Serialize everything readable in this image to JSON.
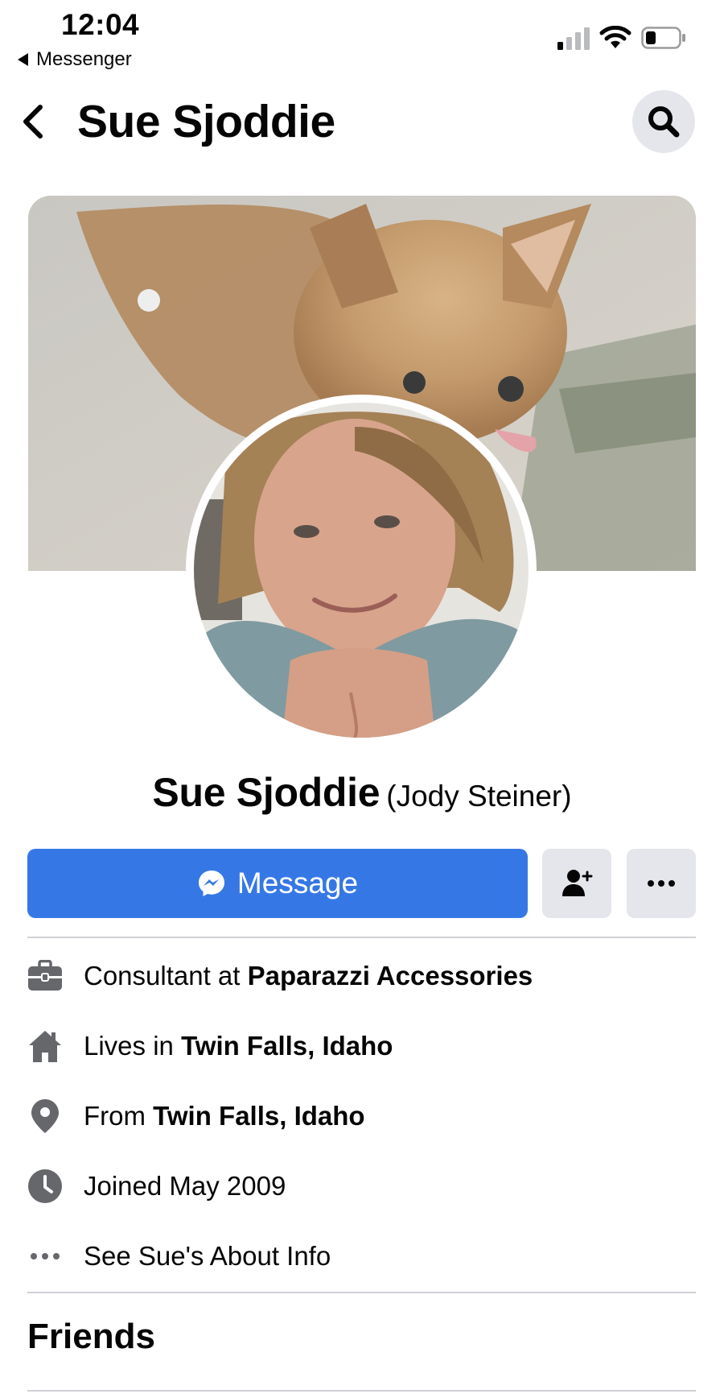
{
  "status_bar": {
    "time": "12:04",
    "back_app_label": "Messenger"
  },
  "header": {
    "title": "Sue Sjoddie"
  },
  "profile": {
    "name": "Sue Sjoddie",
    "alternate_name": "(Jody Steiner)"
  },
  "actions": {
    "message_label": "Message"
  },
  "intro": [
    {
      "icon": "briefcase-icon",
      "prefix": "Consultant at ",
      "bold": "Paparazzi Accessories"
    },
    {
      "icon": "home-icon",
      "prefix": "Lives in ",
      "bold": "Twin Falls, Idaho"
    },
    {
      "icon": "location-pin-icon",
      "prefix": "From ",
      "bold": "Twin Falls, Idaho"
    },
    {
      "icon": "clock-icon",
      "prefix": "Joined May 2009",
      "bold": ""
    },
    {
      "icon": "more-dots-icon",
      "prefix": "See Sue's About Info",
      "bold": ""
    }
  ],
  "friends": {
    "title": "Friends"
  },
  "colors": {
    "primary_button": "#3578e5",
    "secondary_button": "#e4e6eb",
    "icon_gray": "#65676b",
    "divider": "#ced0d4"
  }
}
